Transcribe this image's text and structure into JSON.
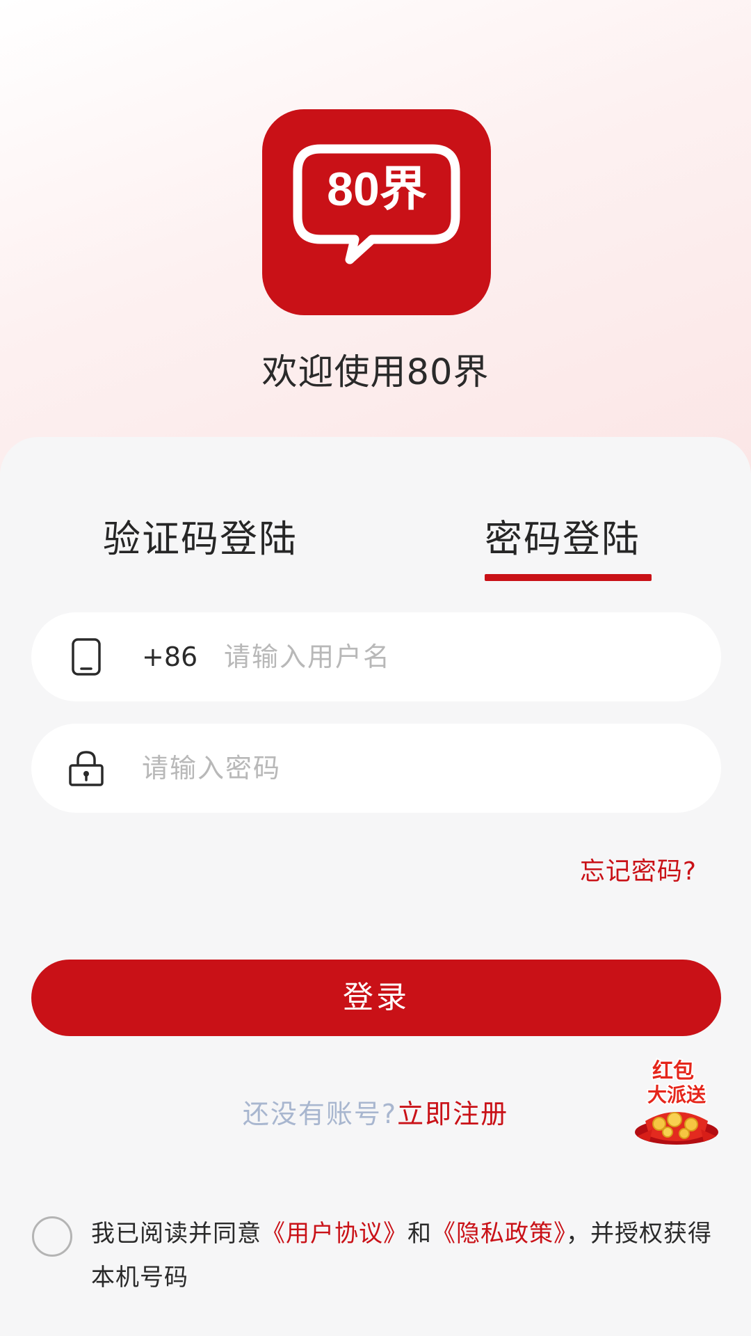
{
  "app": {
    "logo_text": "80界",
    "welcome": "欢迎使用80界"
  },
  "tabs": [
    {
      "label": "验证码登陆",
      "active": false
    },
    {
      "label": "密码登陆",
      "active": true
    }
  ],
  "form": {
    "country_code": "+86",
    "username_placeholder": "请输入用户名",
    "password_placeholder": "请输入密码",
    "username_icon": "phone-icon",
    "password_icon": "lock-icon"
  },
  "forgot_password": "忘记密码?",
  "login_button": "登录",
  "register": {
    "prompt": "还没有账号?",
    "link": "立即注册"
  },
  "promo": {
    "icon": "red-packet-icon",
    "line1": "红包",
    "line2": "大派送"
  },
  "agreement": {
    "checked": false,
    "prefix": "我已阅读并同意",
    "user_agreement": "《用户协议》",
    "and": "和",
    "privacy_policy": "《隐私政策》",
    "suffix": "，并授权获得本机号码"
  },
  "colors": {
    "brand": "#c91117",
    "placeholder": "#b8b8b8",
    "muted_blue": "#a8b6cf",
    "background": "#f6f6f7"
  }
}
